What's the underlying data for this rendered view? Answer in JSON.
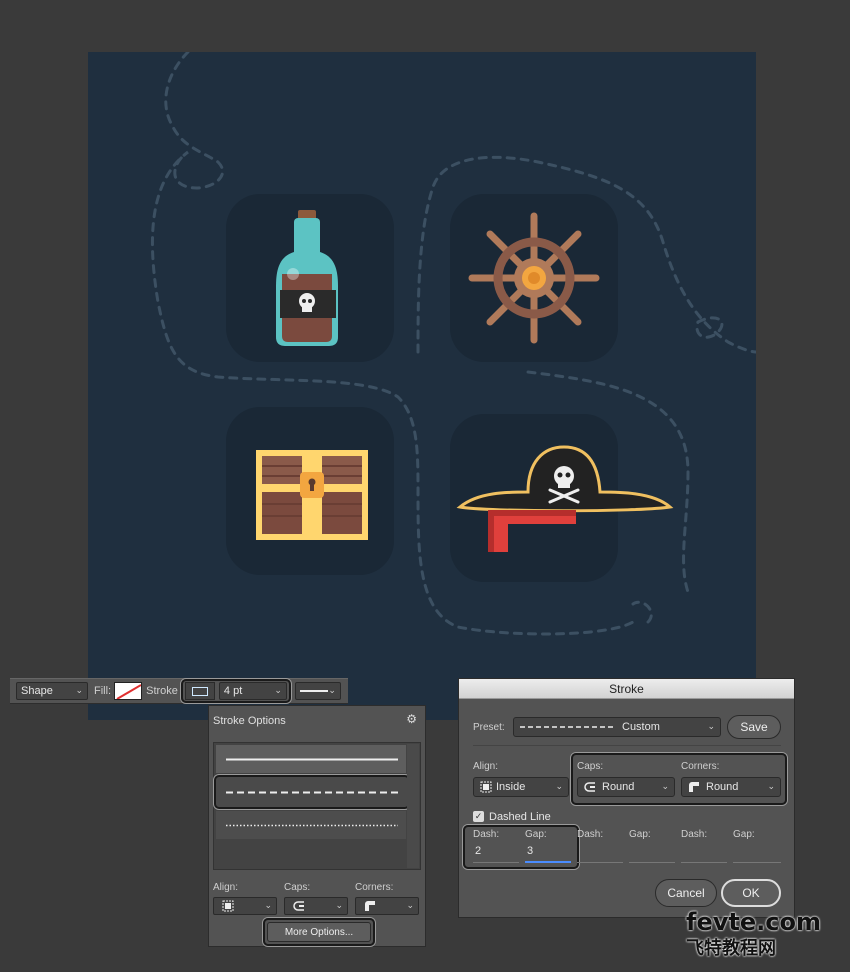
{
  "options_bar": {
    "tool_mode": "Shape",
    "fill_label": "Fill:",
    "stroke_label": "Stroke",
    "stroke_width": "4 pt"
  },
  "stroke_options_panel": {
    "title": "Stroke Options",
    "presets": [
      "solid",
      "dashed",
      "dotted"
    ],
    "selected_preset": "dashed",
    "align_label": "Align:",
    "caps_label": "Caps:",
    "corners_label": "Corners:",
    "more_options_label": "More Options..."
  },
  "stroke_dialog": {
    "title": "Stroke",
    "preset_label": "Preset:",
    "preset_value": "Custom",
    "save_label": "Save",
    "align_label": "Align:",
    "align_value": "Inside",
    "caps_label": "Caps:",
    "caps_value": "Round",
    "corners_label": "Corners:",
    "corners_value": "Round",
    "dashed_line_label": "Dashed Line",
    "dashed_line_checked": true,
    "dash_label": "Dash:",
    "gap_label": "Gap:",
    "dash1": "2",
    "gap1": "3",
    "cancel_label": "Cancel",
    "ok_label": "OK"
  },
  "artboard": {
    "icons": [
      "rum-bottle-icon",
      "ship-wheel-icon",
      "treasure-chest-icon",
      "pirate-hat-icon"
    ],
    "colors": {
      "background": "#1f2f3f",
      "tile": "#1a2836",
      "path": "#3c5062"
    }
  },
  "watermark": {
    "line1": "fevte.com",
    "line2": "飞特教程网"
  }
}
